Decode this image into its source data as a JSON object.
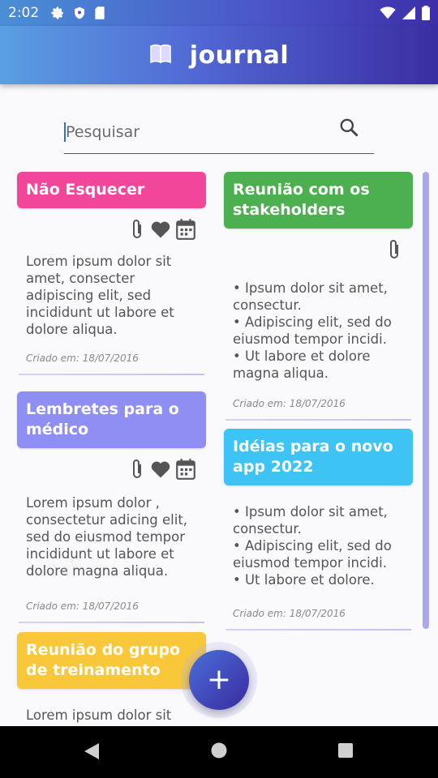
{
  "status_bar": {
    "time": "2:02",
    "left_icons": [
      "gear-icon",
      "shield-icon",
      "sd-card-icon"
    ],
    "right_icons": [
      "wifi-icon",
      "signal-icon",
      "battery-icon"
    ]
  },
  "app_bar": {
    "title": "journal",
    "icon": "book-icon"
  },
  "search": {
    "placeholder": "Pesquisar",
    "value": ""
  },
  "colors": {
    "pink": "#f2469a",
    "green": "#4caf50",
    "lavender": "#8f8ef2",
    "cyan": "#3ec3f5",
    "yellow": "#f9c73a",
    "fab": "#3a2aa0"
  },
  "notes": [
    {
      "title": "Não Esquecer",
      "icons": [
        "paperclip-icon",
        "heart-icon",
        "calendar-icon"
      ],
      "body": "Lorem ipsum dolor sit\namet, consecter\nadipiscing elit, sed\nincididunt ut labore et\ndolore aliqua.",
      "date": "Criado em: 18/07/2016"
    },
    {
      "title": "Reunião com os stakeholders",
      "icons": [
        "paperclip-icon"
      ],
      "body": "• Ipsum dolor sit amet,\nconsectur.\n• Adipiscing elit, sed do\neiusmod tempor incidi.\n• Ut labore et dolore\nmagna aliqua.",
      "date": "Criado em: 18/07/2016"
    },
    {
      "title": "Lembretes para o médico",
      "icons": [
        "paperclip-icon",
        "heart-icon",
        "calendar-icon"
      ],
      "body": "Lorem ipsum dolor ,\nconsectetur adicing elit,\nsed do eiusmod tempor\nincididunt ut labore et\ndolore magna aliqua.",
      "date": "Criado em: 18/07/2016"
    },
    {
      "title": "Idéias para o novo app 2022",
      "icons": [],
      "body": "• Ipsum dolor sit amet,\nconsectur.\n• Adipiscing elit, sed do\neiusmod tempor incidi.\n• Ut labore et dolore.",
      "date": "Criado em: 18/07/2016"
    },
    {
      "title": "Reunião do grupo de treinamento",
      "icons": [],
      "body": "Lorem ipsum dolor sit",
      "date": ""
    }
  ],
  "fab": {
    "label": "+"
  },
  "nav_bar": {
    "buttons": [
      "back-icon",
      "home-icon",
      "recents-icon"
    ]
  }
}
